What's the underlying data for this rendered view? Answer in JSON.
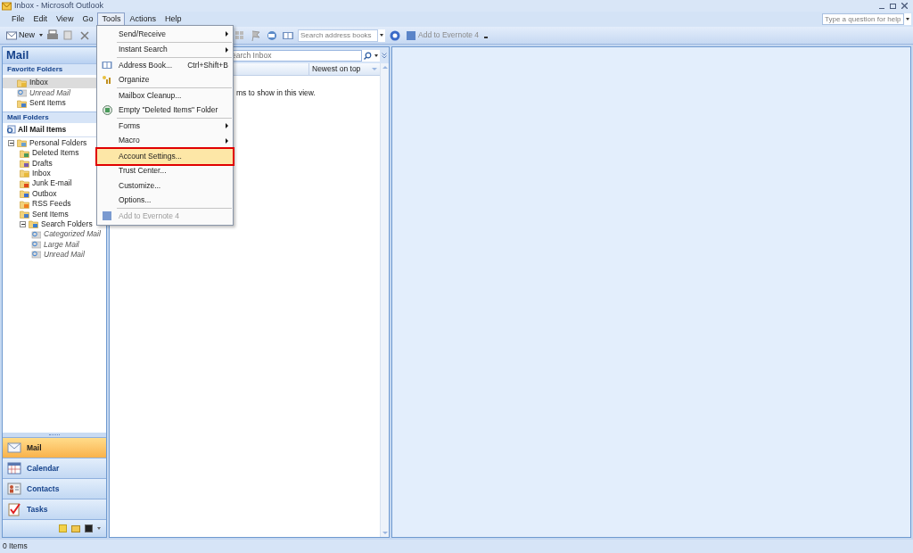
{
  "window": {
    "title": "Inbox - Microsoft Outlook"
  },
  "menu_bar": [
    {
      "label": "File",
      "selected": false
    },
    {
      "label": "Edit",
      "selected": false
    },
    {
      "label": "View",
      "selected": false
    },
    {
      "label": "Go",
      "selected": false
    },
    {
      "label": "Tools",
      "selected": true
    },
    {
      "label": "Actions",
      "selected": false
    },
    {
      "label": "Help",
      "selected": false
    }
  ],
  "help_search": {
    "placeholder": "Type a question for help"
  },
  "toolbar": {
    "new_button": "New",
    "address_search": {
      "placeholder": "Search address books"
    },
    "evernote_button": "Add to Evernote 4"
  },
  "navigation": {
    "title": "Mail",
    "favorites_header": "Favorite Folders",
    "favorites": [
      {
        "label": "Inbox",
        "kind": "inbox",
        "italic": false,
        "selected": true
      },
      {
        "label": "Unread Mail",
        "kind": "search",
        "italic": true,
        "selected": false
      },
      {
        "label": "Sent Items",
        "kind": "sent",
        "italic": false,
        "selected": false
      }
    ],
    "mail_folders_header": "Mail Folders",
    "all_items": "All Mail Items",
    "tree": [
      {
        "label": "Personal Folders",
        "kind": "personal",
        "italic": false,
        "expanded": true,
        "children": [
          {
            "label": "Deleted Items",
            "kind": "deleted",
            "italic": false
          },
          {
            "label": "Drafts",
            "kind": "drafts",
            "italic": false
          },
          {
            "label": "Inbox",
            "kind": "inbox",
            "italic": false
          },
          {
            "label": "Junk E-mail",
            "kind": "junk",
            "italic": false
          },
          {
            "label": "Outbox",
            "kind": "outbox",
            "italic": false
          },
          {
            "label": "RSS Feeds",
            "kind": "rss",
            "italic": false
          },
          {
            "label": "Sent Items",
            "kind": "sent",
            "italic": false
          },
          {
            "label": "Search Folders",
            "kind": "searchfolders",
            "italic": false,
            "expanded": true,
            "children": [
              {
                "label": "Categorized Mail",
                "kind": "search",
                "italic": true
              },
              {
                "label": "Large Mail",
                "kind": "search",
                "italic": true
              },
              {
                "label": "Unread Mail",
                "kind": "search",
                "italic": true
              }
            ]
          }
        ]
      }
    ],
    "buttons": [
      {
        "label": "Mail",
        "kind": "mail",
        "selected": true
      },
      {
        "label": "Calendar",
        "kind": "calendar",
        "selected": false
      },
      {
        "label": "Contacts",
        "kind": "contacts",
        "selected": false
      },
      {
        "label": "Tasks",
        "kind": "tasks",
        "selected": false
      }
    ]
  },
  "message_list": {
    "search": {
      "placeholder": "earch Inbox"
    },
    "sort": "Newest on top",
    "empty_text": "ms to show in this view."
  },
  "tools_menu": [
    {
      "label": "Send/Receive",
      "kind": "none",
      "submenu": true,
      "disabled": false,
      "selected": false,
      "separator_before": false
    },
    {
      "label": "Instant Search",
      "kind": "none",
      "submenu": true,
      "disabled": false,
      "selected": false,
      "separator_before": true
    },
    {
      "label": "Address Book...",
      "kind": "book",
      "shortcut": "Ctrl+Shift+B",
      "submenu": false,
      "disabled": false,
      "selected": false,
      "separator_before": true
    },
    {
      "label": "Organize",
      "kind": "organize",
      "submenu": false,
      "disabled": false,
      "selected": false,
      "separator_before": false
    },
    {
      "label": "Mailbox Cleanup...",
      "kind": "none",
      "submenu": false,
      "disabled": false,
      "selected": false,
      "separator_before": true
    },
    {
      "label": "Empty \"Deleted Items\" Folder",
      "kind": "bin",
      "submenu": false,
      "disabled": false,
      "selected": false,
      "separator_before": false
    },
    {
      "label": "Forms",
      "kind": "none",
      "submenu": true,
      "disabled": false,
      "selected": false,
      "separator_before": true
    },
    {
      "label": "Macro",
      "kind": "none",
      "submenu": true,
      "disabled": false,
      "selected": false,
      "separator_before": false
    },
    {
      "label": "Account Settings...",
      "kind": "none",
      "submenu": false,
      "disabled": false,
      "selected": true,
      "separator_before": true
    },
    {
      "label": "Trust Center...",
      "kind": "none",
      "submenu": false,
      "disabled": false,
      "selected": false,
      "separator_before": false
    },
    {
      "label": "Customize...",
      "kind": "none",
      "submenu": false,
      "disabled": false,
      "selected": false,
      "separator_before": false
    },
    {
      "label": "Options...",
      "kind": "none",
      "submenu": false,
      "disabled": false,
      "selected": false,
      "separator_before": false
    },
    {
      "label": "Add to Evernote 4",
      "kind": "evernote",
      "submenu": false,
      "disabled": true,
      "selected": false,
      "separator_before": true
    }
  ],
  "status_bar": {
    "text": "0 Items"
  }
}
